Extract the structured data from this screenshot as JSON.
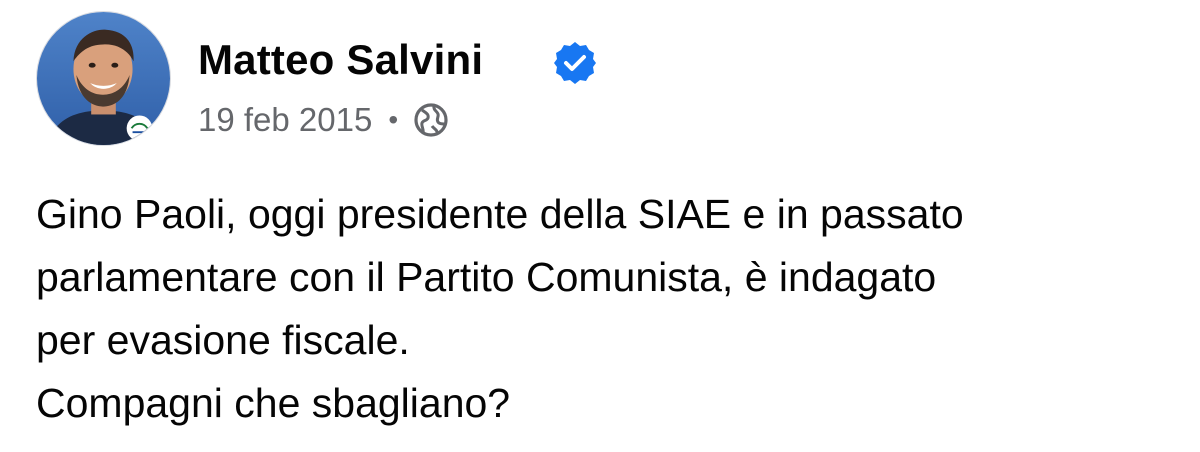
{
  "author": {
    "name": "Matteo Salvini",
    "verified": true,
    "avatar_icon": "profile-photo"
  },
  "meta": {
    "date": "19 feb 2015",
    "separator": "•",
    "audience_icon": "globe-icon"
  },
  "post": {
    "lines": [
      "Gino Paoli, oggi presidente della SIAE e in passato",
      "parlamentare con il Partito Comunista, è indagato",
      "per evasione fiscale.",
      "Compagni che sbagliano?"
    ]
  },
  "colors": {
    "verified_blue": "#1877f2",
    "meta_gray": "#65676b",
    "text": "#050505"
  }
}
